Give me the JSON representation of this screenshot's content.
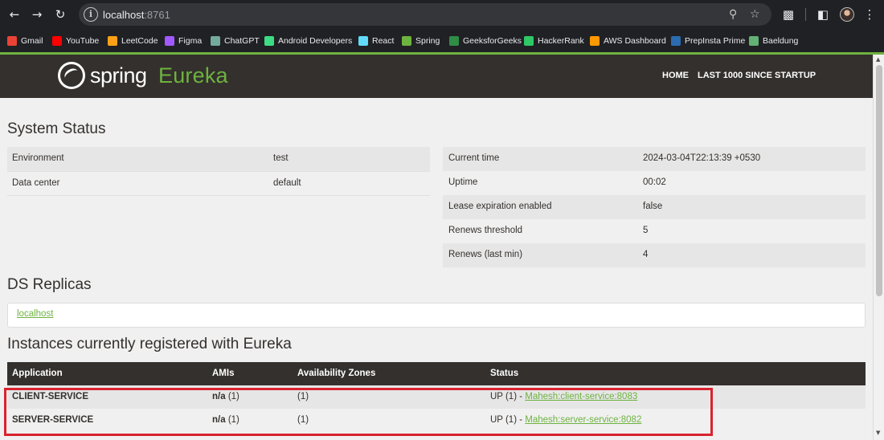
{
  "browser": {
    "nav_icons": {
      "back": "arrow-left-icon",
      "forward": "arrow-right-icon",
      "reload": "reload-icon"
    },
    "url_host": "localhost",
    "url_port": ":8761",
    "toolbar_icons": [
      "zoom-icon",
      "star-icon",
      "extensions-icon",
      "side-panel-icon",
      "profile-avatar",
      "kebab-menu-icon"
    ],
    "bookmarks": [
      {
        "label": "Gmail",
        "color": "#ea4335"
      },
      {
        "label": "YouTube",
        "color": "#ff0000"
      },
      {
        "label": "LeetCode",
        "color": "#ffa116"
      },
      {
        "label": "Figma",
        "color": "#a259ff"
      },
      {
        "label": "ChatGPT",
        "color": "#74aa9c"
      },
      {
        "label": "Android Developers",
        "color": "#3ddc84"
      },
      {
        "label": "React",
        "color": "#61dafb"
      },
      {
        "label": "Spring",
        "color": "#6db33f"
      },
      {
        "label": "GeeksforGeeks",
        "color": "#2f8d46"
      },
      {
        "label": "HackerRank",
        "color": "#2ec866"
      },
      {
        "label": "AWS Dashboard",
        "color": "#ff9900"
      },
      {
        "label": "PrepInsta Prime",
        "color": "#2b6cb0"
      },
      {
        "label": "Baeldung",
        "color": "#63b175"
      }
    ]
  },
  "header": {
    "logo_spring": "spring",
    "logo_eureka": "Eureka",
    "nav_home": "HOME",
    "nav_last1000": "LAST 1000 SINCE STARTUP"
  },
  "system_status": {
    "title": "System Status",
    "left": [
      {
        "label": "Environment",
        "value": "test"
      },
      {
        "label": "Data center",
        "value": "default"
      }
    ],
    "right": [
      {
        "label": "Current time",
        "value": "2024-03-04T22:13:39 +0530"
      },
      {
        "label": "Uptime",
        "value": "00:02"
      },
      {
        "label": "Lease expiration enabled",
        "value": "false"
      },
      {
        "label": "Renews threshold",
        "value": "5"
      },
      {
        "label": "Renews (last min)",
        "value": "4"
      }
    ]
  },
  "ds_replicas": {
    "title": "DS Replicas",
    "link": "localhost"
  },
  "instances": {
    "title": "Instances currently registered with Eureka",
    "columns": [
      "Application",
      "AMIs",
      "Availability Zones",
      "Status"
    ],
    "rows": [
      {
        "application": "CLIENT-SERVICE",
        "ami_bold": "n/a",
        "ami_count": " (1)",
        "zones": "(1)",
        "status_prefix": "UP (1) - ",
        "instance_link": "Mahesh:client-service:8083"
      },
      {
        "application": "SERVER-SERVICE",
        "ami_bold": "n/a",
        "ami_count": " (1)",
        "zones": "(1)",
        "status_prefix": "UP (1) - ",
        "instance_link": "Mahesh:server-service:8082"
      }
    ]
  },
  "colors": {
    "spring_green": "#6db33f",
    "header_dark": "#34302d",
    "highlight_red": "#d9232e"
  }
}
